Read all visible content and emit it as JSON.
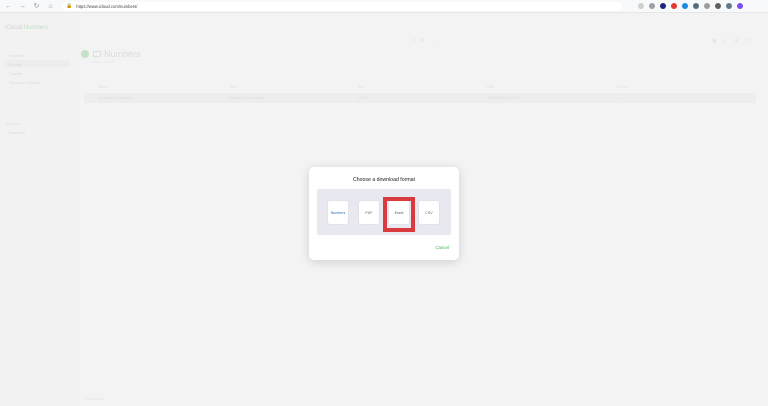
{
  "browser": {
    "url": "https://www.icloud.com/numbers/",
    "back_icon": "←",
    "forward_icon": "→",
    "reload_icon": "↻",
    "home_icon": "⌂",
    "lock_icon": "🔒"
  },
  "app": {
    "brand": "iCloud",
    "brand_accent": "Numbers",
    "sidebar_items": [
      "Recents",
      "Browse",
      "Shared",
      "Recently Deleted"
    ],
    "sidebar_heading": "Folders",
    "sidebar_folder": "Numbers",
    "folder_title": "Numbers",
    "subtitle": "1 item · 12 KB",
    "columns": [
      "Name",
      "Kind",
      "Size",
      "Date",
      "Shared"
    ],
    "row": {
      "name": "Numbers Spreadsheet",
      "kind": "Numbers Spreadsheet",
      "size": "12 KB",
      "date": "12/05/2023 10:22 PM",
      "shared": "—"
    },
    "footer": "1 Numbers"
  },
  "modal": {
    "title": "Choose a download format",
    "options": [
      "Numbers",
      "PDF",
      "Excel",
      "CSV"
    ],
    "selected": "Excel",
    "cancel": "Cancel"
  },
  "colors": {
    "accent_green": "#44b34a",
    "highlight_red": "#d93a3e",
    "numbers_blue": "#2d6fb4"
  }
}
